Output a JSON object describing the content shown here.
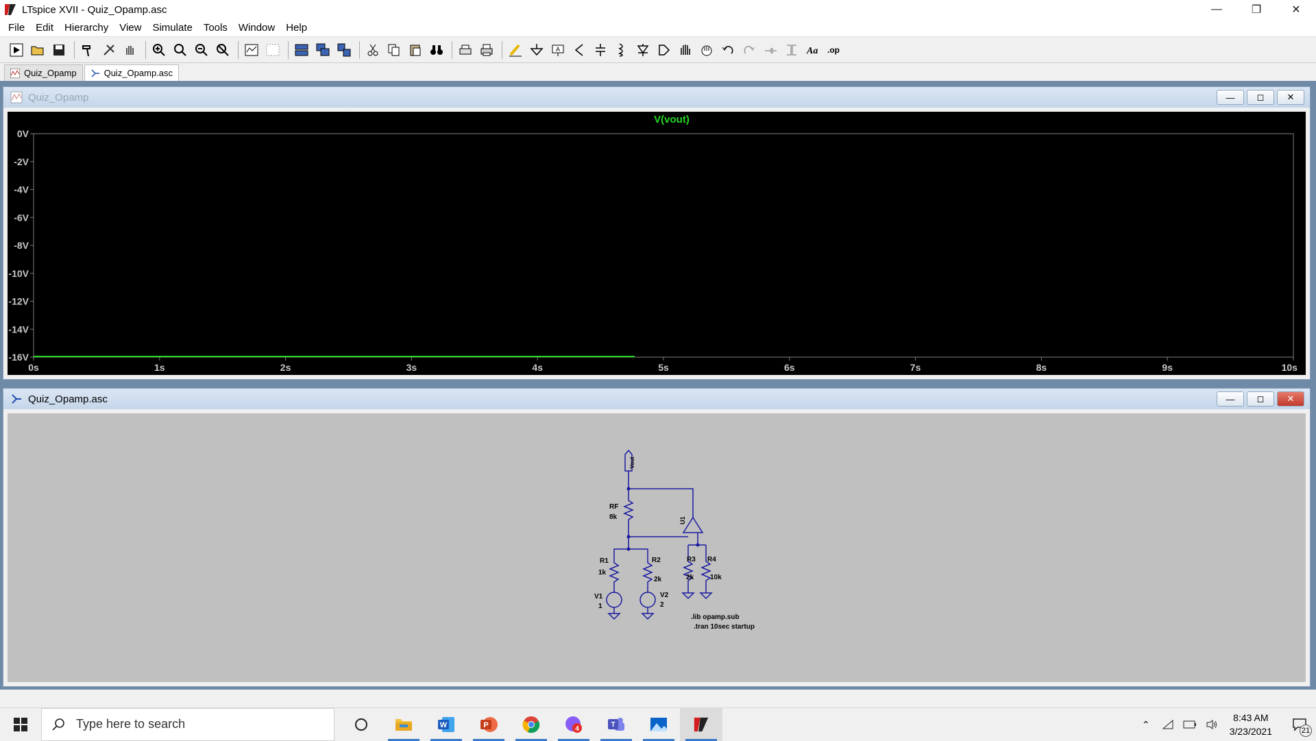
{
  "window": {
    "title": "LTspice XVII - Quiz_Opamp.asc"
  },
  "menu": [
    "File",
    "Edit",
    "Hierarchy",
    "View",
    "Simulate",
    "Tools",
    "Window",
    "Help"
  ],
  "tabs": [
    {
      "label": "Quiz_Opamp",
      "icon": "waveform-icon"
    },
    {
      "label": "Quiz_Opamp.asc",
      "icon": "schematic-icon"
    }
  ],
  "plot_window": {
    "title": "Quiz_Opamp",
    "trace_label": "V(vout)",
    "trace_color": "#22d822",
    "grid_color": "#808080"
  },
  "chart_data": {
    "type": "line",
    "title": "V(vout)",
    "xlabel": "",
    "ylabel": "",
    "xlim": [
      0,
      10
    ],
    "ylim": [
      -16,
      0
    ],
    "xticks": [
      "0s",
      "1s",
      "2s",
      "3s",
      "4s",
      "5s",
      "6s",
      "7s",
      "8s",
      "9s",
      "10s"
    ],
    "yticks": [
      "0V",
      "-2V",
      "-4V",
      "-6V",
      "-8V",
      "-10V",
      "-12V",
      "-14V",
      "-16V"
    ],
    "series": [
      {
        "name": "V(vout)",
        "x": [
          0,
          4.77
        ],
        "y": [
          -16,
          -16
        ]
      }
    ]
  },
  "schematic_window": {
    "title": "Quiz_Opamp.asc",
    "wire_color": "#1a1aa0",
    "labels": {
      "vout": "Vout",
      "rf_name": "RF",
      "rf_val": "8k",
      "u1": "U1",
      "r1_name": "R1",
      "r1_val": "1k",
      "r2_name": "R2",
      "r2_val": "2k",
      "r3_name": "R3",
      "r3_val": "2k",
      "r4_name": "R4",
      "r4_val": "10k",
      "v1_name": "V1",
      "v1_val": "1",
      "v2_name": "V2",
      "v2_val": "2",
      "directive1": ".lib opamp.sub",
      "directive2": ".tran 10sec startup"
    }
  },
  "taskbar": {
    "search_placeholder": "Type here to search",
    "time": "8:43 AM",
    "date": "3/23/2021",
    "notification_count": "21",
    "messenger_badge": "4"
  }
}
